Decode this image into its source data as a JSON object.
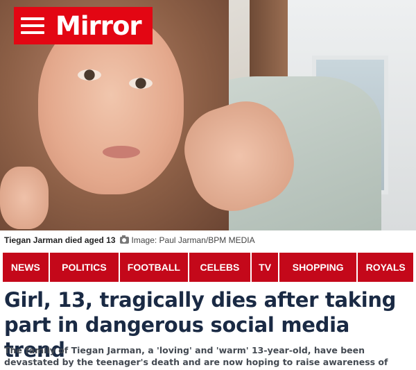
{
  "brand": {
    "logo_text": "Mirror",
    "accent_color": "#e30613",
    "nav_color": "#c4081a",
    "menu_icon": "hamburger-menu-icon"
  },
  "hero": {
    "caption_main": "Tiegan Jarman died aged 13",
    "caption_icon": "camera-icon",
    "caption_credit": "Image: Paul Jarman/BPM MEDIA"
  },
  "nav": {
    "items": [
      {
        "label": "NEWS"
      },
      {
        "label": "POLITICS"
      },
      {
        "label": "FOOTBALL"
      },
      {
        "label": "CELEBS"
      },
      {
        "label": "TV"
      },
      {
        "label": "SHOPPING"
      },
      {
        "label": "ROYALS"
      }
    ]
  },
  "article": {
    "headline": "Girl, 13, tragically dies after taking part in dangerous social media trend",
    "standfirst": "The family of Tiegan Jarman, a 'loving' and 'warm' 13-year-old, have been devastated by the teenager's death and are now hoping to raise awareness of dangerous social media trends",
    "headline_color": "#1a2a44"
  }
}
